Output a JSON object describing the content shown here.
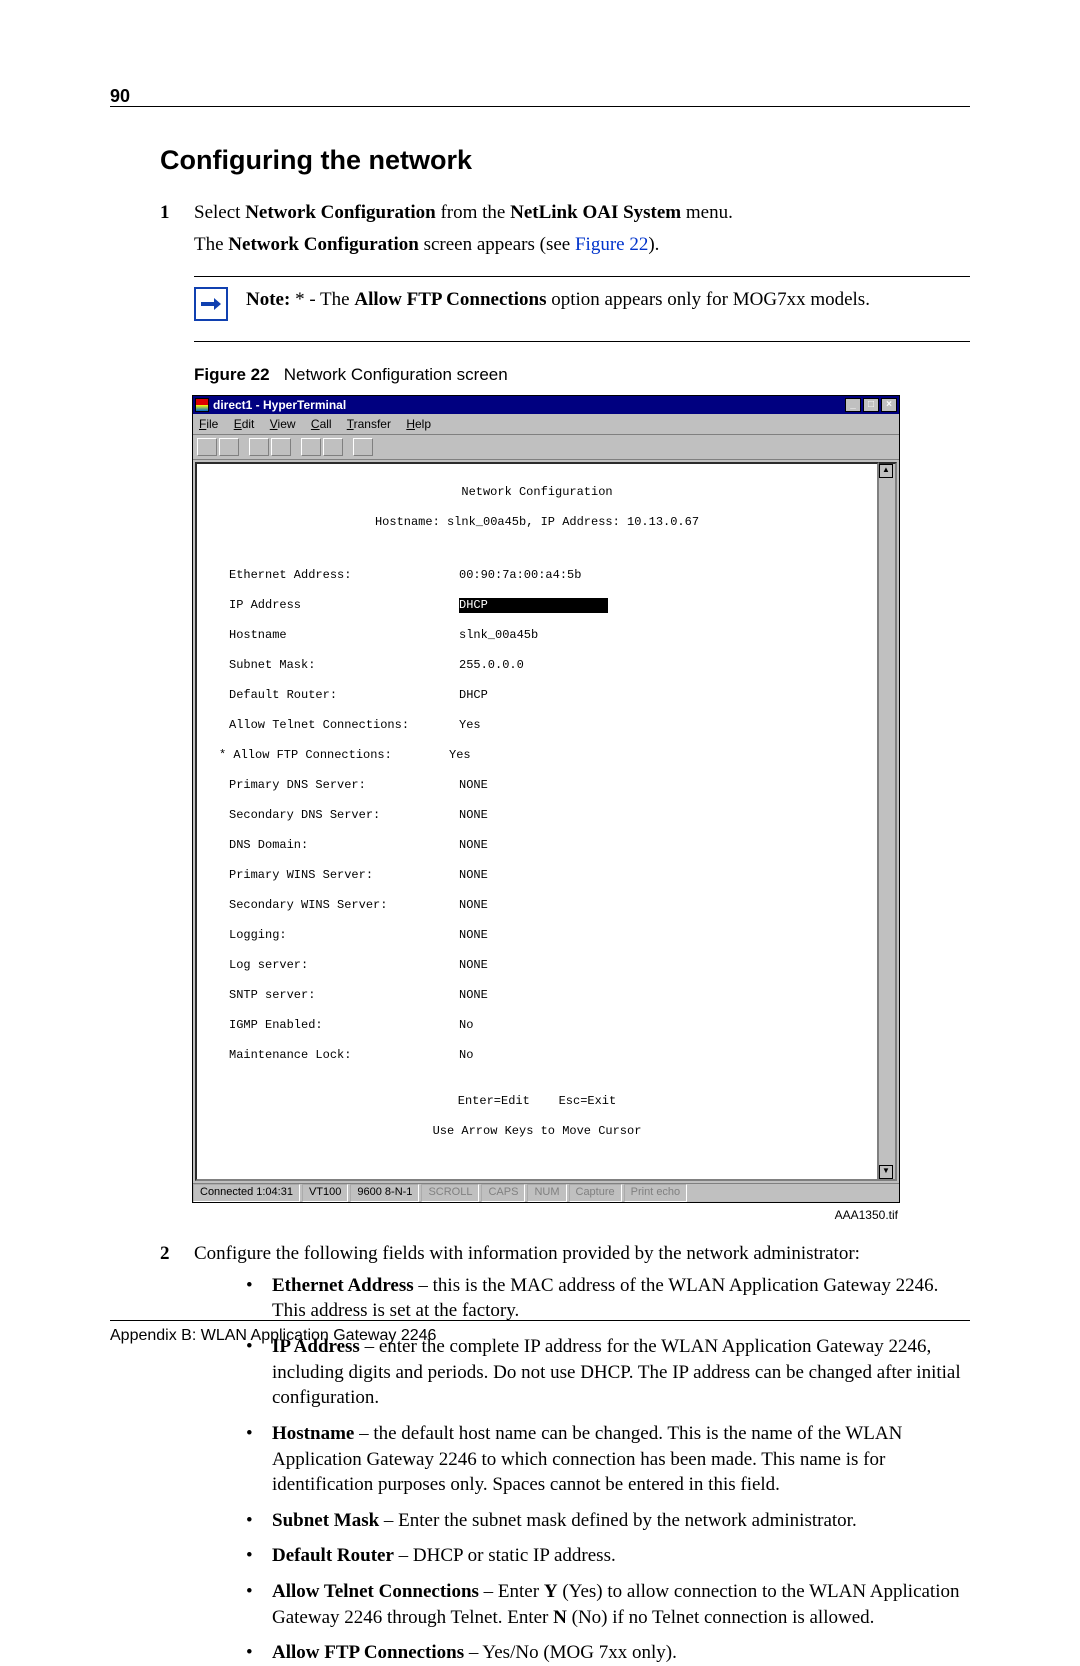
{
  "page_number": "90",
  "heading": "Configuring the network",
  "step1": {
    "pre": "Select ",
    "b1": "Network Configuration",
    "mid": " from the ",
    "b2": "NetLink OAI System",
    "post": " menu."
  },
  "step1_para": {
    "pre": "The ",
    "b1": "Network Configuration",
    "mid": " screen appears (see ",
    "link": "Figure 22",
    "post": ")."
  },
  "note": {
    "b1": "Note:",
    "mid": " * - The ",
    "b2": "Allow FTP Connections",
    "post": " option appears only for MOG7xx models."
  },
  "figure": {
    "label": "Figure 22",
    "caption": "Network Configuration screen"
  },
  "ht": {
    "title": "direct1 - HyperTerminal",
    "menu": {
      "file": "File",
      "edit": "Edit",
      "view": "View",
      "call": "Call",
      "transfer": "Transfer",
      "help": "Help"
    },
    "term_title": "Network Configuration",
    "term_sub": "Hostname: slnk_00a45b, IP Address: 10.13.0.67",
    "rows": {
      "eth_l": "Ethernet Address:",
      "eth_v": "00:90:7a:00:a4:5b",
      "ip_l": "IP Address",
      "ip_v": "DHCP",
      "hn_l": "Hostname",
      "hn_v": "slnk_00a45b",
      "sm_l": "Subnet Mask:",
      "sm_v": "255.0.0.0",
      "dr_l": "Default Router:",
      "dr_v": "DHCP",
      "tel_l": "Allow Telnet Connections:",
      "tel_v": "Yes",
      "ftp_l": "* Allow FTP Connections:",
      "ftp_v": "Yes",
      "pdns_l": "Primary DNS Server:",
      "pdns_v": "NONE",
      "sdns_l": "Secondary DNS Server:",
      "sdns_v": "NONE",
      "dom_l": "DNS Domain:",
      "dom_v": "NONE",
      "pwin_l": "Primary WINS Server:",
      "pwin_v": "NONE",
      "swin_l": "Secondary WINS Server:",
      "swin_v": "NONE",
      "log_l": "Logging:",
      "log_v": "NONE",
      "lsv_l": "Log server:",
      "lsv_v": "NONE",
      "sntp_l": "SNTP server:",
      "sntp_v": "NONE",
      "igmp_l": "IGMP Enabled:",
      "igmp_v": "No",
      "mlk_l": "Maintenance Lock:",
      "mlk_v": "No"
    },
    "foot1": "Enter=Edit    Esc=Exit",
    "foot2": "Use Arrow Keys to Move Cursor",
    "status": {
      "conn": "Connected 1:04:31",
      "emu": "VT100",
      "port": "9600 8-N-1",
      "scroll": "SCROLL",
      "caps": "CAPS",
      "num": "NUM",
      "capture": "Capture",
      "echo": "Print echo"
    },
    "image_id": "AAA1350.tif"
  },
  "step2_intro": "Configure the following fields with information provided by the network administrator:",
  "bullets": {
    "b1": {
      "b": "Ethernet Address",
      "t": " – this is the MAC address of the WLAN Application Gateway 2246. This address is set at the factory."
    },
    "b2": {
      "b": "IP Address",
      "t": " – enter the complete IP address for the WLAN Application Gateway 2246, including digits and periods. Do not use DHCP. The IP address can be changed after initial configuration."
    },
    "b3": {
      "b": "Hostname",
      "t": " – the default host name can be changed. This is the name of the WLAN Application Gateway 2246 to which connection has been made. This name is for identification purposes only. Spaces cannot be entered in this field."
    },
    "b4": {
      "b": "Subnet Mask",
      "t": " – Enter the subnet mask defined by the network administrator."
    },
    "b5": {
      "b": "Default Router",
      "t": " – DHCP or static IP address."
    },
    "b6": {
      "b": "Allow Telnet Connections",
      "t1": " – Enter ",
      "bY": "Y",
      "t2": " (Yes) to allow connection to the WLAN Application Gateway 2246 through Telnet. Enter ",
      "bN": "N",
      "t3": " (No) if no Telnet connection is allowed."
    },
    "b7": {
      "b": "Allow FTP Connections",
      "t": " – Yes/No (MOG 7xx only)."
    }
  },
  "footer": "Appendix B: WLAN Application Gateway 2246"
}
